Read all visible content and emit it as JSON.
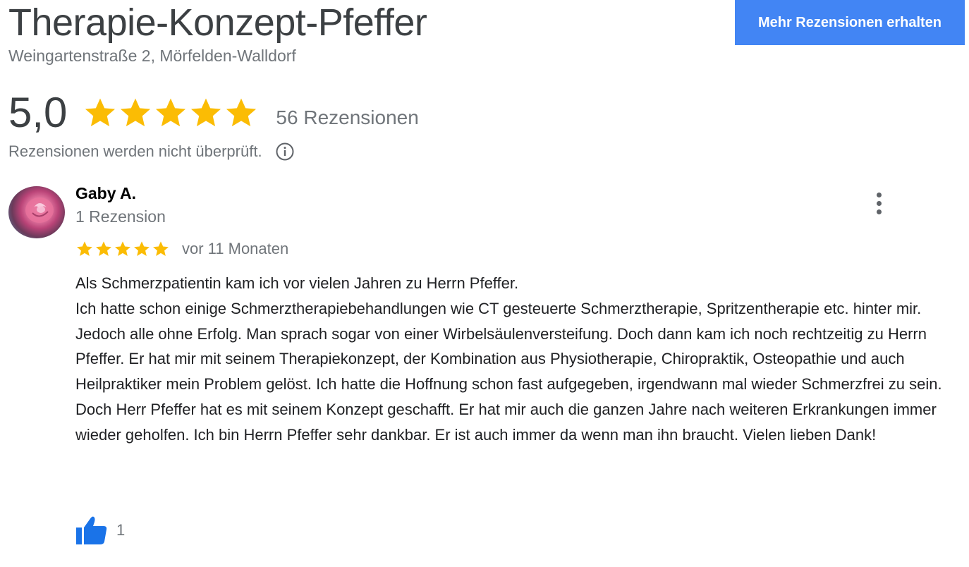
{
  "business": {
    "name": "Therapie-Konzept-Pfeffer",
    "address": "Weingartenstraße 2, Mörfelden-Walldorf"
  },
  "actions": {
    "get_more_reviews_label": "Mehr Rezensionen erhalten"
  },
  "summary": {
    "rating": "5,0",
    "stars": 5,
    "review_count_label": "56 Rezensionen",
    "disclaimer": "Rezensionen werden nicht überprüft."
  },
  "review": {
    "author": "Gaby A.",
    "author_meta": "1 Rezension",
    "stars": 5,
    "time": "vor 11 Monaten",
    "text_lines": [
      "Als Schmerzpatientin kam ich vor vielen Jahren zu Herrn Pfeffer.",
      "Ich hatte schon einige Schmerztherapiebehandlungen wie CT gesteuerte Schmerztherapie, Spritzentherapie etc. hinter mir. Jedoch alle ohne Erfolg. Man sprach sogar von einer Wirbelsäulenversteifung. Doch dann kam ich noch rechtzeitig zu Herrn Pfeffer. Er hat mir mit seinem Therapiekonzept, der Kombination aus Physiotherapie, Chiropraktik, Osteopathie und auch Heilpraktiker mein Problem gelöst. Ich hatte die Hoffnung schon fast aufgegeben, irgendwann mal wieder Schmerzfrei zu sein. Doch Herr Pfeffer hat es mit seinem Konzept geschafft. Er hat mir auch die ganzen Jahre nach weiteren Erkrankungen immer wieder geholfen. Ich bin Herrn Pfeffer sehr dankbar. Er ist auch immer da wenn man ihn braucht. Vielen lieben Dank!"
    ],
    "likes": "1"
  },
  "colors": {
    "star": "#fbbc04",
    "accent_button": "#4285f4",
    "like_icon": "#1a73e8",
    "muted_text": "#70757a"
  },
  "icons": {
    "star": "star-icon",
    "info": "info-icon",
    "more": "more-vert-icon",
    "like": "thumb-up-icon"
  }
}
